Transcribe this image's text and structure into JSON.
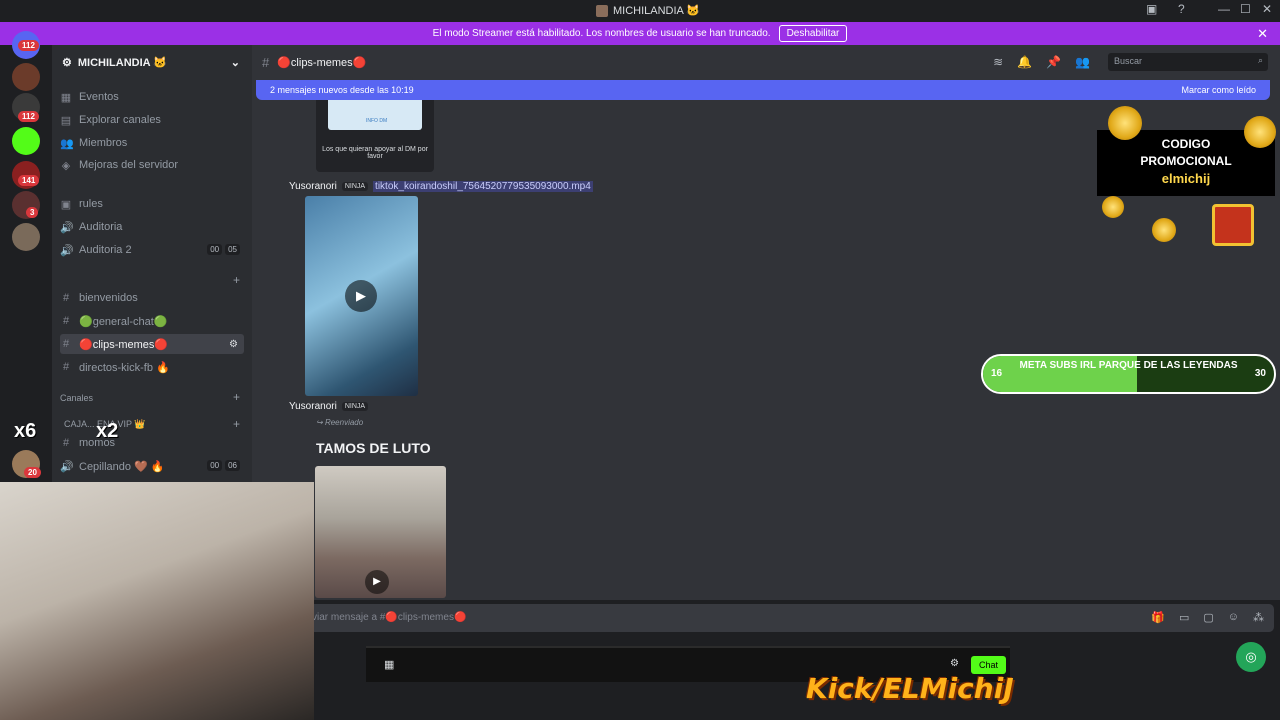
{
  "window": {
    "title": "MICHILANDIA 🐱"
  },
  "banner": {
    "text": "El modo Streamer está habilitado. Los nombres de usuario se han truncado.",
    "button": "Deshabilitar"
  },
  "rail": {
    "badges": [
      "112",
      "112",
      "141",
      "3",
      "20"
    ]
  },
  "sidebar": {
    "server_name": "MICHILANDIA 🐱",
    "top_items": [
      "Eventos",
      "Explorar canales",
      "Miembros",
      "Mejoras del servidor"
    ],
    "channels": [
      {
        "name": "rules"
      },
      {
        "name": "Auditoria"
      },
      {
        "name": "Auditoria 2",
        "counts": [
          "00",
          "05"
        ]
      },
      {
        "name": "bienvenidos"
      },
      {
        "name": "🟢general-chat🟢"
      },
      {
        "name": "🔴clips-memes🔴"
      },
      {
        "name": "directos-kick-fb 🔥"
      },
      {
        "name": "momos"
      },
      {
        "name": "Cepillando 🤎 🔥",
        "counts": [
          "00",
          "06"
        ]
      }
    ],
    "category_canales": "Canales",
    "category_vip": "CAJA... ENA VIP 👑"
  },
  "header": {
    "channel": "🔴clips-memes🔴",
    "search_placeholder": "Buscar"
  },
  "new_messages": {
    "text": "2 mensajes nuevos desde las 10:19",
    "mark_read": "Marcar como leído"
  },
  "messages": [
    {
      "image_caption": "Los que quieran apoyar al DM por favor",
      "image_label": "INFO DM"
    },
    {
      "author": "Yusoranori",
      "tag": "NINJA",
      "attachment": "tiktok_koirandoshil_7564520779535093000.mp4"
    },
    {
      "author": "Yusoranori",
      "tag": "NINJA",
      "forwarded": "Reenviado",
      "heading": "TAMOS DE LUTO"
    }
  ],
  "composer": {
    "placeholder": "viar mensaje a #🔴clips-memes🔴"
  },
  "overlay": {
    "promo": {
      "line1": "CODIGO",
      "line2": "PROMOCIONAL",
      "code": "elmichij"
    },
    "goal": {
      "label": "META SUBS IRL PARQUE DE LAS LEYENDAS",
      "current": "16",
      "target": "30",
      "progress": 0.53
    },
    "kick": {
      "chat_button": "Chat",
      "logo": "Kick/ELMichiJ"
    },
    "multipliers": [
      "x6",
      "x2"
    ]
  },
  "colors": {
    "banner": "#9b30e6",
    "blurple": "#5865f2",
    "kick_green": "#53fc18"
  }
}
